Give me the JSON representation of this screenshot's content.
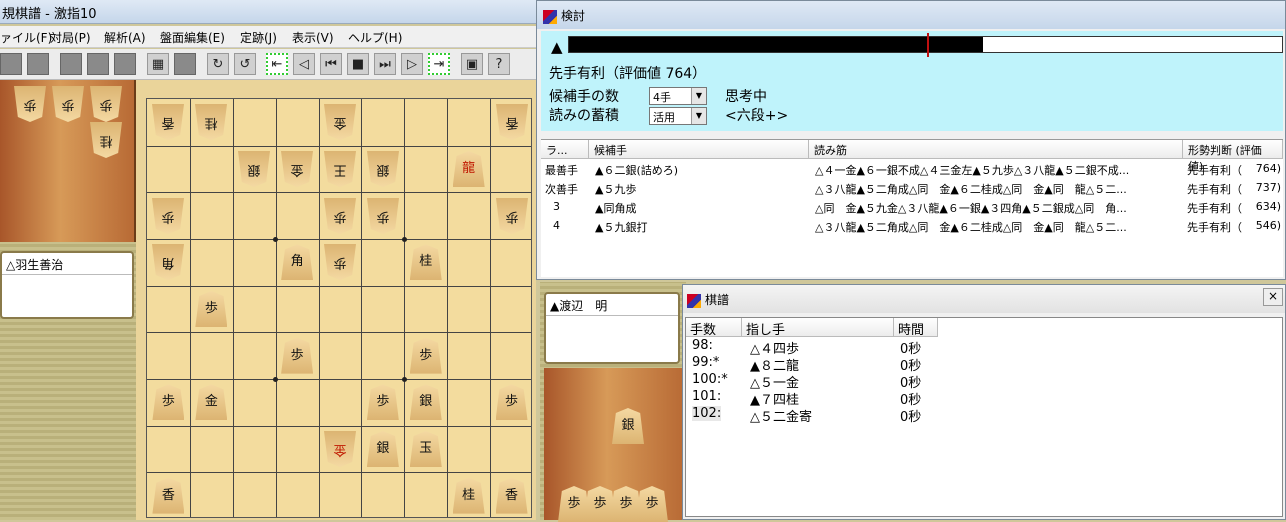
{
  "main_window": {
    "title": "規棋譜 - 激指10",
    "menu": [
      "ァイル(F)",
      "対局(P)",
      "解析(A)",
      "盤面編集(E)",
      "定跡(J)",
      "表示(V)",
      "ヘルプ(H)"
    ]
  },
  "toolbar": {
    "icons": [
      "new-icon",
      "open-icon",
      "save-icon",
      "print-icon",
      "copy-icon",
      "paste-icon",
      "board-edit-icon",
      "blank-icon",
      "analyze-icon",
      "analyze2-icon",
      "first-move-icon",
      "prev-10-icon",
      "prev-icon",
      "stop-icon",
      "next-icon",
      "next-10-icon",
      "last-move-icon",
      "display-icon",
      "help-icon"
    ]
  },
  "players": {
    "gote_name": "△羽生善治",
    "sente_name": "▲渡辺　明"
  },
  "board": {
    "gote_hand": [
      "歩",
      "歩",
      "歩",
      "桂"
    ],
    "sente_hand": [
      "銀",
      "歩",
      "歩",
      "歩",
      "歩"
    ],
    "pieces": [
      {
        "c": 1,
        "r": 1,
        "t": "香",
        "g": true
      },
      {
        "c": 2,
        "r": 1,
        "t": "桂",
        "g": true
      },
      {
        "c": 5,
        "r": 1,
        "t": "金",
        "g": true
      },
      {
        "c": 9,
        "r": 1,
        "t": "香",
        "g": true
      },
      {
        "c": 3,
        "r": 2,
        "t": "銀",
        "g": true
      },
      {
        "c": 4,
        "r": 2,
        "t": "金",
        "g": true
      },
      {
        "c": 5,
        "r": 2,
        "t": "王",
        "g": true
      },
      {
        "c": 6,
        "r": 2,
        "t": "銀",
        "g": true
      },
      {
        "c": 8,
        "r": 2,
        "t": "龍",
        "g": false,
        "red": true
      },
      {
        "c": 1,
        "r": 3,
        "t": "歩",
        "g": true
      },
      {
        "c": 5,
        "r": 3,
        "t": "歩",
        "g": true
      },
      {
        "c": 6,
        "r": 3,
        "t": "歩",
        "g": true
      },
      {
        "c": 9,
        "r": 3,
        "t": "歩",
        "g": true
      },
      {
        "c": 1,
        "r": 4,
        "t": "角",
        "g": true
      },
      {
        "c": 4,
        "r": 4,
        "t": "角",
        "g": false
      },
      {
        "c": 5,
        "r": 4,
        "t": "歩",
        "g": true
      },
      {
        "c": 7,
        "r": 4,
        "t": "桂",
        "g": false
      },
      {
        "c": 2,
        "r": 5,
        "t": "歩",
        "g": false
      },
      {
        "c": 4,
        "r": 6,
        "t": "歩",
        "g": false
      },
      {
        "c": 7,
        "r": 6,
        "t": "歩",
        "g": false
      },
      {
        "c": 1,
        "r": 7,
        "t": "歩",
        "g": false
      },
      {
        "c": 2,
        "r": 7,
        "t": "金",
        "g": false
      },
      {
        "c": 6,
        "r": 7,
        "t": "歩",
        "g": false
      },
      {
        "c": 7,
        "r": 7,
        "t": "銀",
        "g": false
      },
      {
        "c": 9,
        "r": 7,
        "t": "歩",
        "g": false
      },
      {
        "c": 5,
        "r": 8,
        "t": "金",
        "g": true,
        "red": true
      },
      {
        "c": 6,
        "r": 8,
        "t": "銀",
        "g": false
      },
      {
        "c": 7,
        "r": 8,
        "t": "玉",
        "g": false
      },
      {
        "c": 1,
        "r": 9,
        "t": "香",
        "g": false
      },
      {
        "c": 8,
        "r": 9,
        "t": "桂",
        "g": false
      },
      {
        "c": 9,
        "r": 9,
        "t": "香",
        "g": false
      }
    ]
  },
  "analysis": {
    "title": "検討",
    "eval_mark": "▲",
    "eval_fraction": 0.58,
    "status": "先手有利（評価値 764）",
    "candidates_label": "候補手の数",
    "candidates_value": "4手",
    "thinking": "思考中",
    "accumulate_label": "読みの蓄積",
    "accumulate_value": "活用",
    "rank": "<六段+>",
    "headers": [
      "ラ...",
      "候補手",
      "読み筋",
      "形勢判断 (評価値)"
    ],
    "rows": [
      {
        "rank": "最善手",
        "move": "▲６二銀(詰めろ)",
        "line": "△４一金▲６一銀不成△４三金左▲５九歩△３八龍▲５二銀不成...",
        "judge": "先手有利（",
        "score": "764)"
      },
      {
        "rank": "次善手",
        "move": "▲５九歩",
        "line": "△３八龍▲５二角成△同　金▲６二桂成△同　金▲同　龍△５二...",
        "judge": "先手有利（",
        "score": "737)"
      },
      {
        "rank": "3",
        "move": "▲同角成",
        "line": "△同　金▲５九金△３八龍▲６一銀▲３四角▲５二銀成△同　角...",
        "judge": "先手有利（",
        "score": "634)"
      },
      {
        "rank": "4",
        "move": "▲５九銀打",
        "line": "△３八龍▲５二角成△同　金▲６二桂成△同　金▲同　龍△５二...",
        "judge": "先手有利（",
        "score": "546)"
      }
    ]
  },
  "kifu": {
    "title": "棋譜",
    "close": "×",
    "headers": [
      "手数",
      "指し手",
      "時間"
    ],
    "rows": [
      {
        "no": "98:",
        "move": "△４四歩",
        "time": "0秒"
      },
      {
        "no": "99:*",
        "move": "▲８二龍",
        "time": "0秒"
      },
      {
        "no": "100:*",
        "move": "△５一金",
        "time": "0秒"
      },
      {
        "no": "101:",
        "move": "▲７四桂",
        "time": "0秒"
      },
      {
        "no": "102:",
        "move": "△５二金寄",
        "time": "0秒"
      }
    ]
  }
}
